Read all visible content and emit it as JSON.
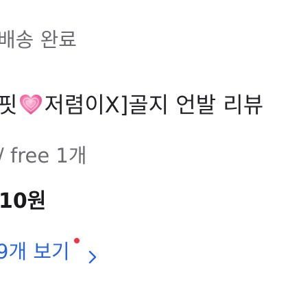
{
  "order": {
    "status": "배송 완료",
    "title_prefix": "핏",
    "title_icon": "pink-heart-icon",
    "title_suffix": "저렴이X]골지 언발 리뷰",
    "option": "/ free 1개",
    "price": "10원",
    "more_link": {
      "label": "9개 보기",
      "badge_color": "#ef3340",
      "icon": "chevron-right-icon"
    }
  },
  "colors": {
    "link": "#2a64dc",
    "muted_text": "#6b6b70",
    "heart": "#f2609a"
  }
}
